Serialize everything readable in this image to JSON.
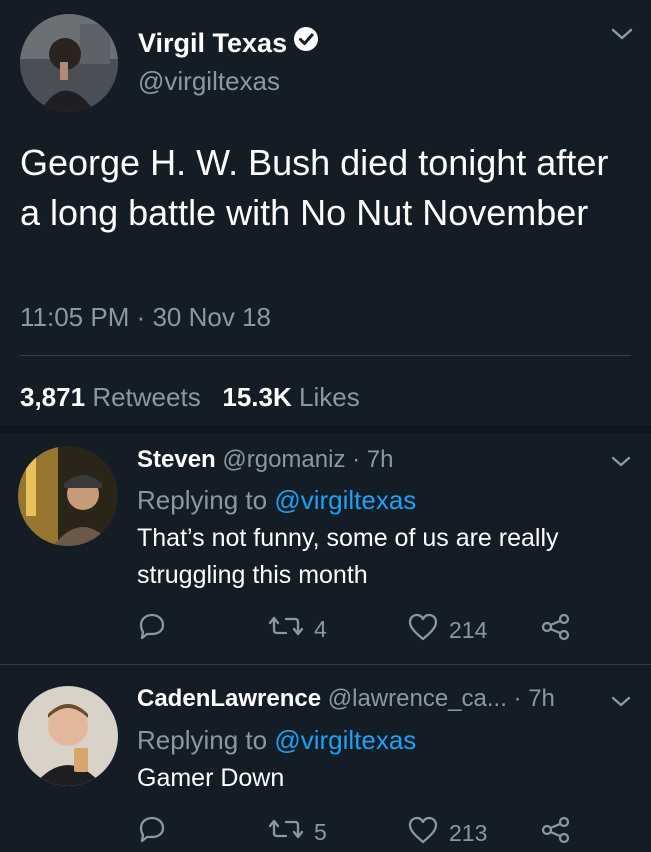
{
  "tweet": {
    "author": {
      "name": "Virgil Texas",
      "handle": "@virgiltexas",
      "verified": true
    },
    "text": "George H. W. Bush died tonight after a long battle with No Nut November",
    "time": "11:05 PM · 30 Nov 18",
    "retweets_count": "3,871",
    "retweets_label": "Retweets",
    "likes_count": "15.3K",
    "likes_label": "Likes"
  },
  "replies": [
    {
      "name": "Steven",
      "handle": "@rgomaniz",
      "age": "· 7h",
      "replying_prefix": "Replying to",
      "replying_to": "@virgiltexas",
      "text": "That’s not funny, some of us are really struggling this month",
      "retweets": "4",
      "likes": "214"
    },
    {
      "name": "CadenLawrence",
      "handle": "@lawrence_ca...",
      "age": "· 7h",
      "replying_prefix": "Replying to",
      "replying_to": "@virgiltexas",
      "text": "Gamer Down",
      "retweets": "5",
      "likes": "213"
    }
  ],
  "colors": {
    "background": "#141d26",
    "muted": "#8899a6",
    "link": "#1da1f2",
    "divider": "#2f3d4a"
  }
}
